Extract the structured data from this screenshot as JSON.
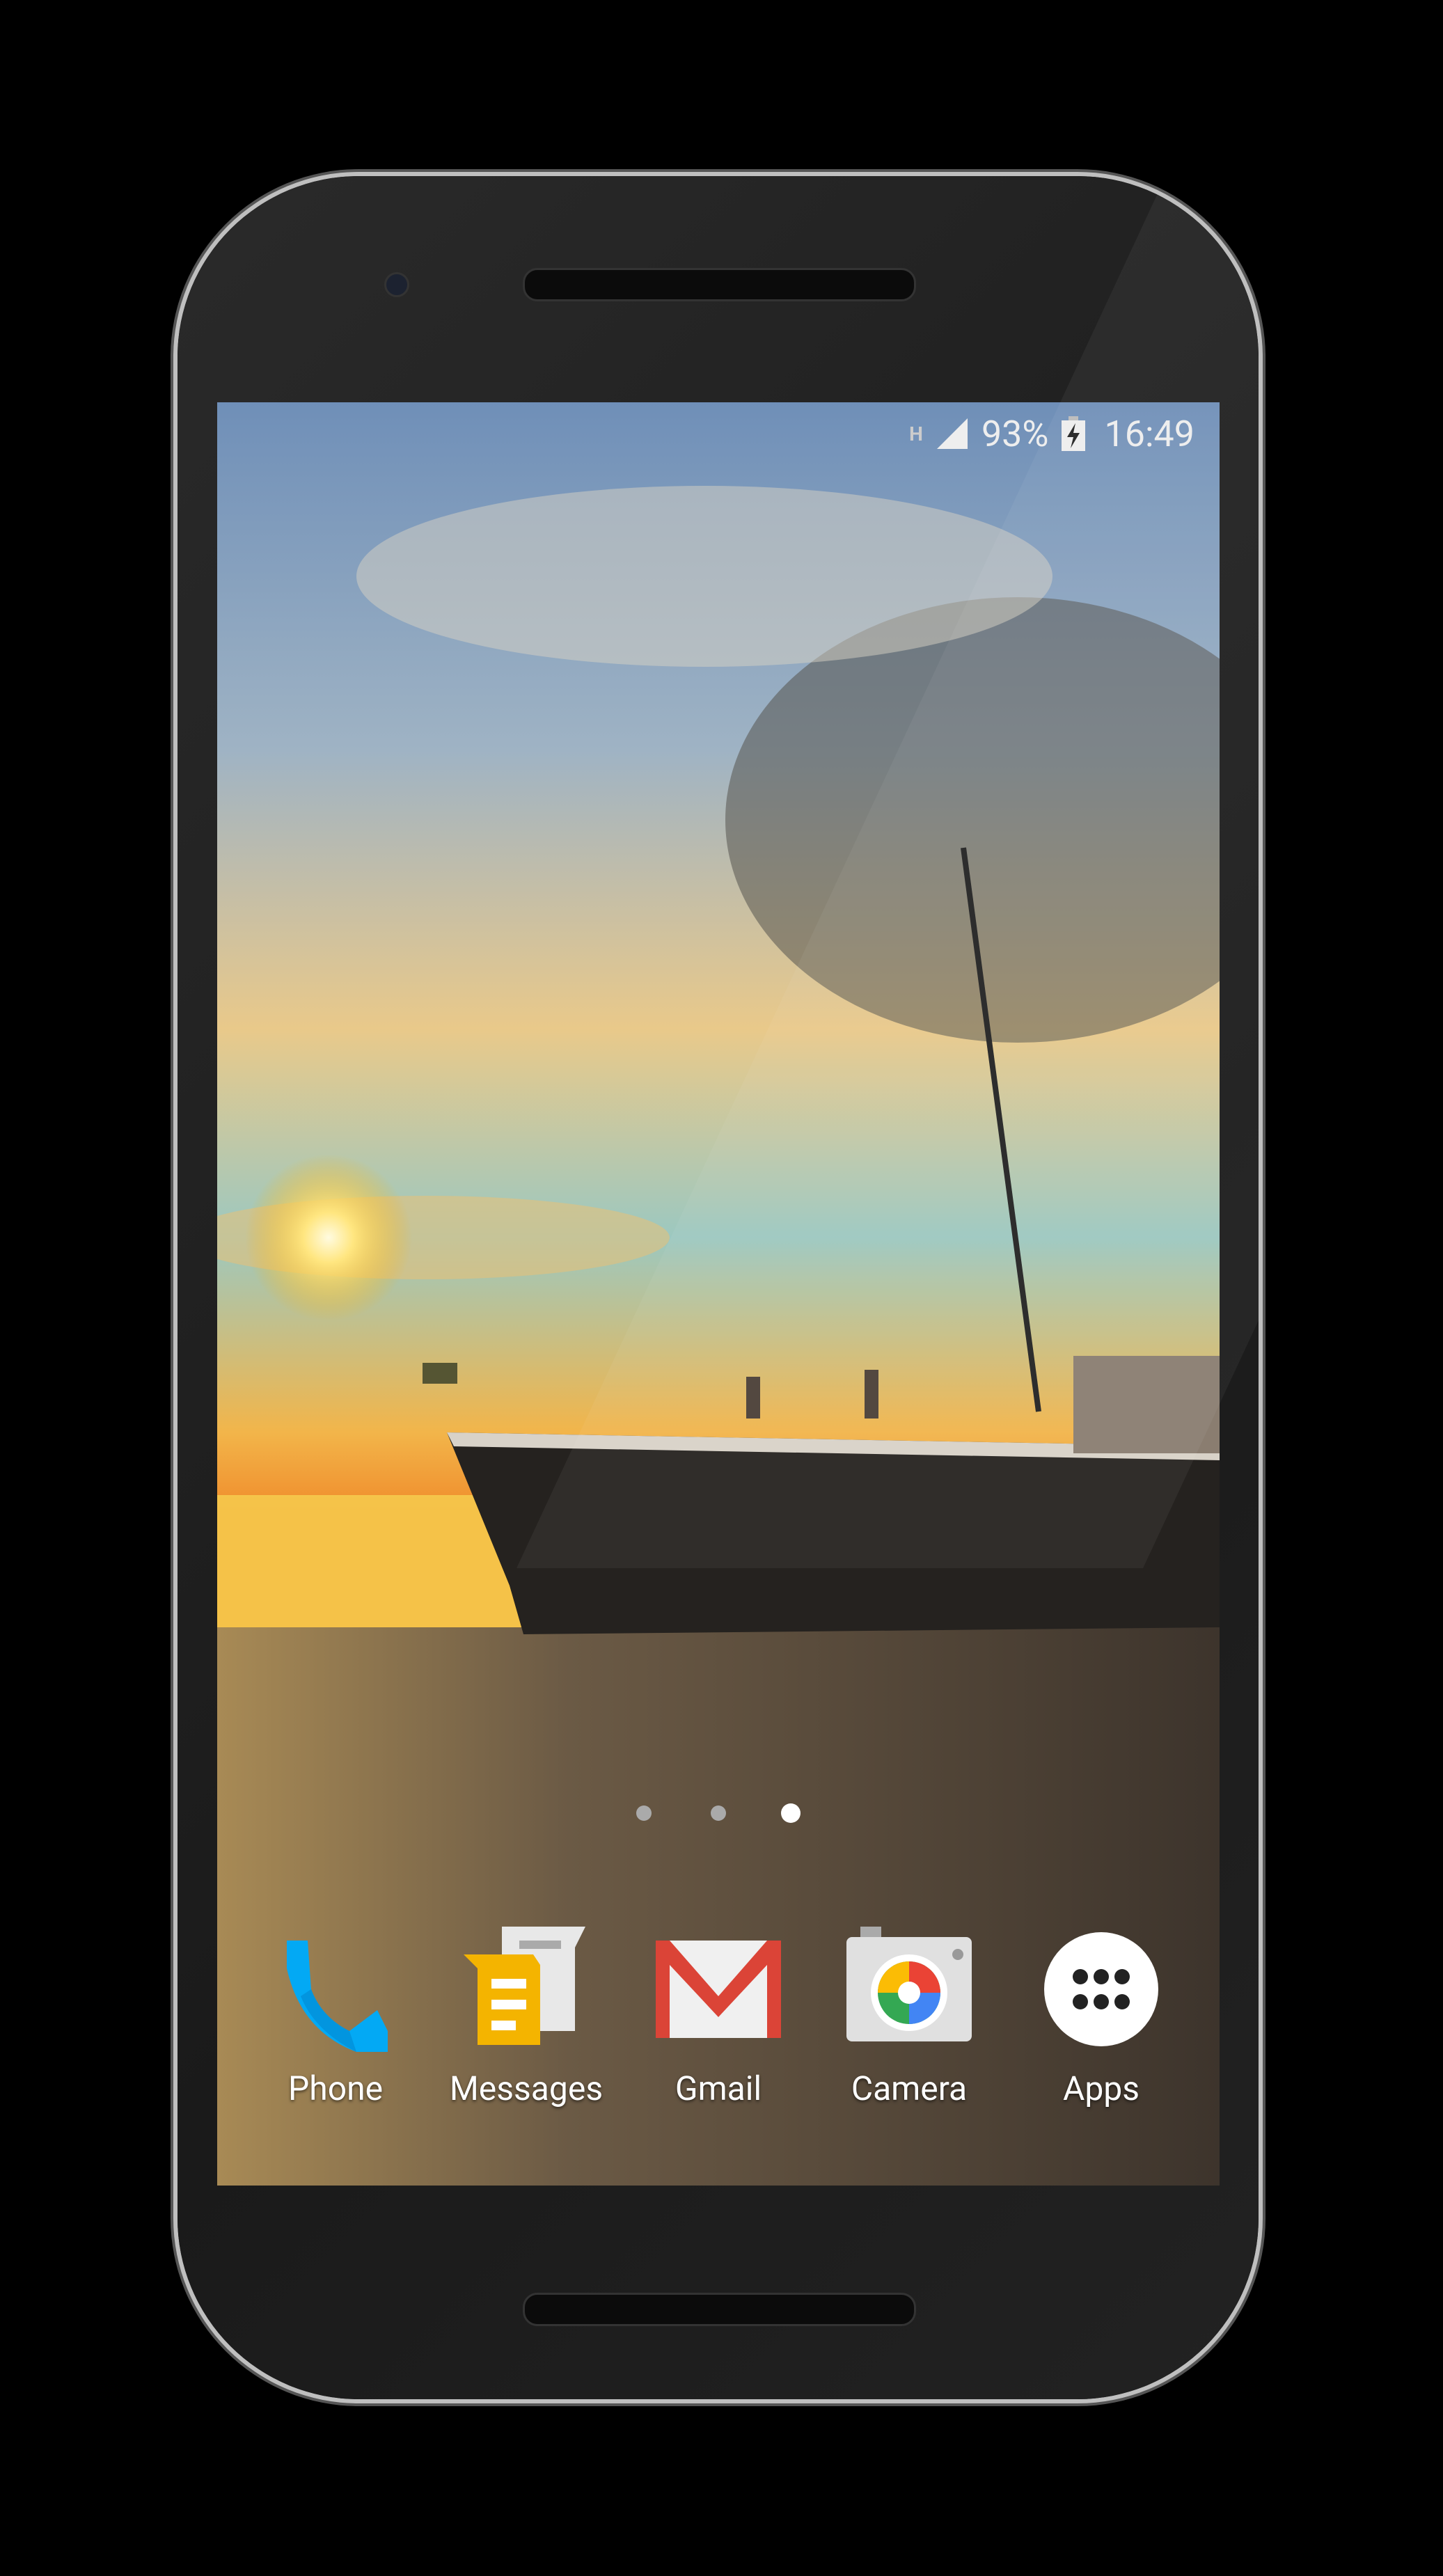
{
  "status_bar": {
    "network_type": "H",
    "signal_icon": "signal-icon",
    "battery_percent": "93%",
    "battery_icon": "battery-charging-icon",
    "time": "16:49"
  },
  "home": {
    "page_count": 3,
    "active_page": 3
  },
  "dock": [
    {
      "label": "Phone",
      "icon": "phone-icon",
      "color": "#03A9F4"
    },
    {
      "label": "Messages",
      "icon": "messages-icon",
      "color": "#F4B400"
    },
    {
      "label": "Gmail",
      "icon": "gmail-icon",
      "color": "#DB4437"
    },
    {
      "label": "Camera",
      "icon": "camera-icon",
      "color": "#E0E0E0"
    },
    {
      "label": "Apps",
      "icon": "apps-grid-icon",
      "color": "#FFFFFF"
    }
  ]
}
